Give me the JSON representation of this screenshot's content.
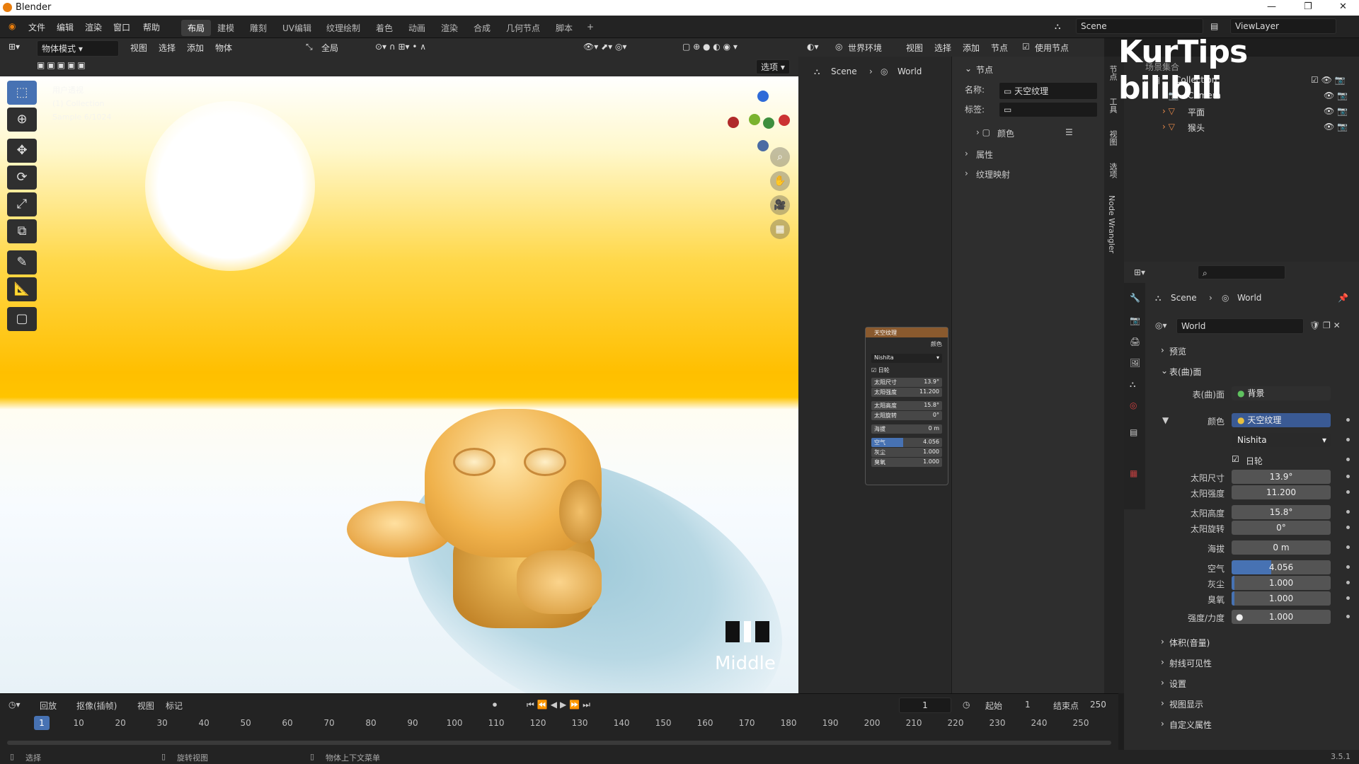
{
  "titlebar": {
    "title": "Blender"
  },
  "menu": [
    "文件",
    "编辑",
    "渲染",
    "窗口",
    "帮助"
  ],
  "workspaces": [
    "布局",
    "建模",
    "雕刻",
    "UV编辑",
    "纹理绘制",
    "着色",
    "动画",
    "渲染",
    "合成",
    "几何节点",
    "脚本"
  ],
  "scene": {
    "name": "Scene",
    "viewlayer": "ViewLayer"
  },
  "viewport": {
    "mode": "物体模式",
    "menus": [
      "视图",
      "选择",
      "添加",
      "物体"
    ],
    "transform": "全局",
    "options": "选项",
    "overlay_lines": [
      "用户透视",
      "(1) Collection",
      "Sample 6/1024"
    ],
    "middle_label": "Middle"
  },
  "node_editor": {
    "world_dropdown": "世界环境",
    "menus": [
      "视图",
      "选择",
      "添加",
      "节点"
    ],
    "use_nodes": "使用节点",
    "breadcrumb": [
      "Scene",
      "World"
    ],
    "panel_title": "节点",
    "name_label": "名称:",
    "name_value": "天空纹理",
    "label_label": "标签:",
    "color_section": "颜色",
    "props_section": "属性",
    "texmap_section": "纹理映射",
    "tabs": [
      "节点",
      "工具",
      "视图",
      "选项",
      "Node Wrangler"
    ],
    "node": {
      "title": "天空纹理",
      "output": "颜色",
      "type": "Nishita",
      "sun_disk": "日轮",
      "rows": [
        [
          "太阳尺寸",
          "13.9°"
        ],
        [
          "太阳强度",
          "11.200"
        ],
        [
          "太阳高度",
          "15.8°"
        ],
        [
          "太阳旋转",
          "0°"
        ],
        [
          "海拔",
          "0 m"
        ],
        [
          "空气",
          "4.056"
        ],
        [
          "灰尘",
          "1.000"
        ],
        [
          "臭氧",
          "1.000"
        ]
      ]
    }
  },
  "outliner": {
    "root": "场景集合",
    "collection": "Collection",
    "items": [
      "Camera",
      "平面",
      "猴头"
    ]
  },
  "properties": {
    "breadcrumb": [
      "Scene",
      "World"
    ],
    "world_name": "World",
    "preview": "预览",
    "surface": "表(曲)面",
    "surface_label": "表(曲)面",
    "surface_value": "背景",
    "color_label": "颜色",
    "color_value": "天空纹理",
    "sky_type": "Nishita",
    "sun_disk": "日轮",
    "fields": [
      {
        "label": "太阳尺寸",
        "value": "13.9°"
      },
      {
        "label": "太阳强度",
        "value": "11.200"
      },
      {
        "label": "太阳高度",
        "value": "15.8°"
      },
      {
        "label": "太阳旋转",
        "value": "0°"
      },
      {
        "label": "海拔",
        "value": "0 m"
      },
      {
        "label": "空气",
        "value": "4.056",
        "fill": 0.4
      },
      {
        "label": "灰尘",
        "value": "1.000",
        "fill": 0.03
      },
      {
        "label": "臭氧",
        "value": "1.000",
        "fill": 0.03
      }
    ],
    "strength_label": "强度/力度",
    "strength_value": "1.000",
    "sections": [
      "体积(音量)",
      "射线可见性",
      "设置",
      "视图显示",
      "自定义属性"
    ]
  },
  "timeline": {
    "menus": [
      "回放",
      "抠像(插帧)",
      "视图",
      "标记"
    ],
    "current": "1",
    "start_label": "起始",
    "start": "1",
    "end_label": "结束点",
    "end": "250",
    "ticks": [
      "10",
      "20",
      "30",
      "40",
      "50",
      "60",
      "70",
      "80",
      "90",
      "100",
      "110",
      "120",
      "130",
      "140",
      "150",
      "160",
      "170",
      "180",
      "190",
      "200",
      "210",
      "220",
      "230",
      "240",
      "250"
    ]
  },
  "status": {
    "left": "选择",
    "mid": "旋转视图",
    "right": "物体上下文菜单",
    "version": "3.5.1"
  },
  "watermark": "KurTips bilibili"
}
